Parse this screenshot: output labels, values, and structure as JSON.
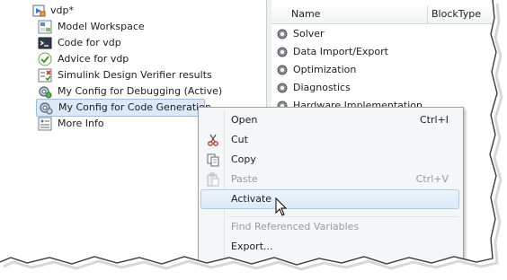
{
  "tree": {
    "root_label": "vdp*",
    "items": [
      {
        "label": "Model Workspace",
        "icon": "workspace-icon"
      },
      {
        "label": "Code for vdp",
        "icon": "code-icon"
      },
      {
        "label": "Advice for vdp",
        "icon": "checkmark-icon"
      },
      {
        "label": "Simulink Design Verifier results",
        "icon": "verifier-icon"
      },
      {
        "label": "My Config for Debugging (Active)",
        "icon": "config-icon"
      },
      {
        "label": "My Config for Code Generation",
        "icon": "config-icon"
      },
      {
        "label": "More Info",
        "icon": "info-icon"
      }
    ],
    "selected_index": 5
  },
  "panel": {
    "columns": [
      "Name",
      "BlockType"
    ],
    "rows": [
      {
        "label": "Solver"
      },
      {
        "label": "Data Import/Export"
      },
      {
        "label": "Optimization"
      },
      {
        "label": "Diagnostics"
      },
      {
        "label": "Hardware Implementation"
      }
    ]
  },
  "context_menu": {
    "items": [
      {
        "label": "Open",
        "shortcut": "Ctrl+I",
        "enabled": true
      },
      {
        "label": "Cut",
        "shortcut": "",
        "enabled": true,
        "icon": "scissors-icon"
      },
      {
        "label": "Copy",
        "shortcut": "",
        "enabled": true,
        "icon": "copy-icon"
      },
      {
        "label": "Paste",
        "shortcut": "Ctrl+V",
        "enabled": false,
        "icon": "paste-icon"
      },
      {
        "label": "Activate",
        "shortcut": "",
        "enabled": true,
        "highlighted": true
      },
      {
        "label": "Find Referenced Variables",
        "shortcut": "",
        "enabled": false
      },
      {
        "label": "Export...",
        "shortcut": "",
        "enabled": true
      }
    ]
  },
  "colors": {
    "selection_bg": "#dbe9f9",
    "menu_bg": "#f5f6f7",
    "highlight_border": "#aecbec",
    "disabled_text": "#9a9a9a"
  }
}
